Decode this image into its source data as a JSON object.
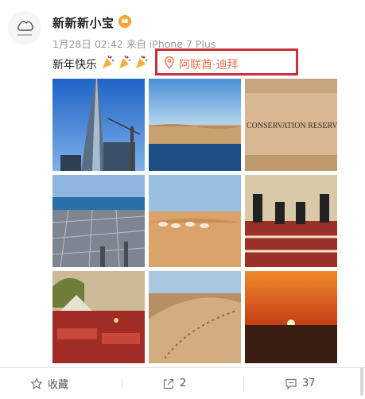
{
  "post": {
    "username": "新新新小宝",
    "meta": "1月28日 02:42 来自 iPhone 7 Plus",
    "text": "新年快乐",
    "location": "阿联酋·迪拜",
    "photos": [
      {
        "scene": "burj-khalifa"
      },
      {
        "scene": "desert-oasis"
      },
      {
        "scene": "conservation-reserve-sign",
        "sign_text": "CONSERVATION RESERVE"
      },
      {
        "scene": "dubai-aerial"
      },
      {
        "scene": "camels-desert"
      },
      {
        "scene": "desert-dinner-musicians"
      },
      {
        "scene": "bedouin-camp"
      },
      {
        "scene": "sand-dune"
      },
      {
        "scene": "desert-sunset"
      }
    ]
  },
  "actions": {
    "favorite_label": "收藏",
    "repost_count": "2",
    "comment_count": "37"
  },
  "colors": {
    "location_text": "#eb7350",
    "highlight_box": "#c8303b",
    "meta_text": "#9a9a9a"
  },
  "icons": [
    "avatar",
    "vip-badge-icon",
    "location-pin-icon",
    "party-popper-icon",
    "star-icon",
    "share-icon",
    "comment-icon"
  ]
}
